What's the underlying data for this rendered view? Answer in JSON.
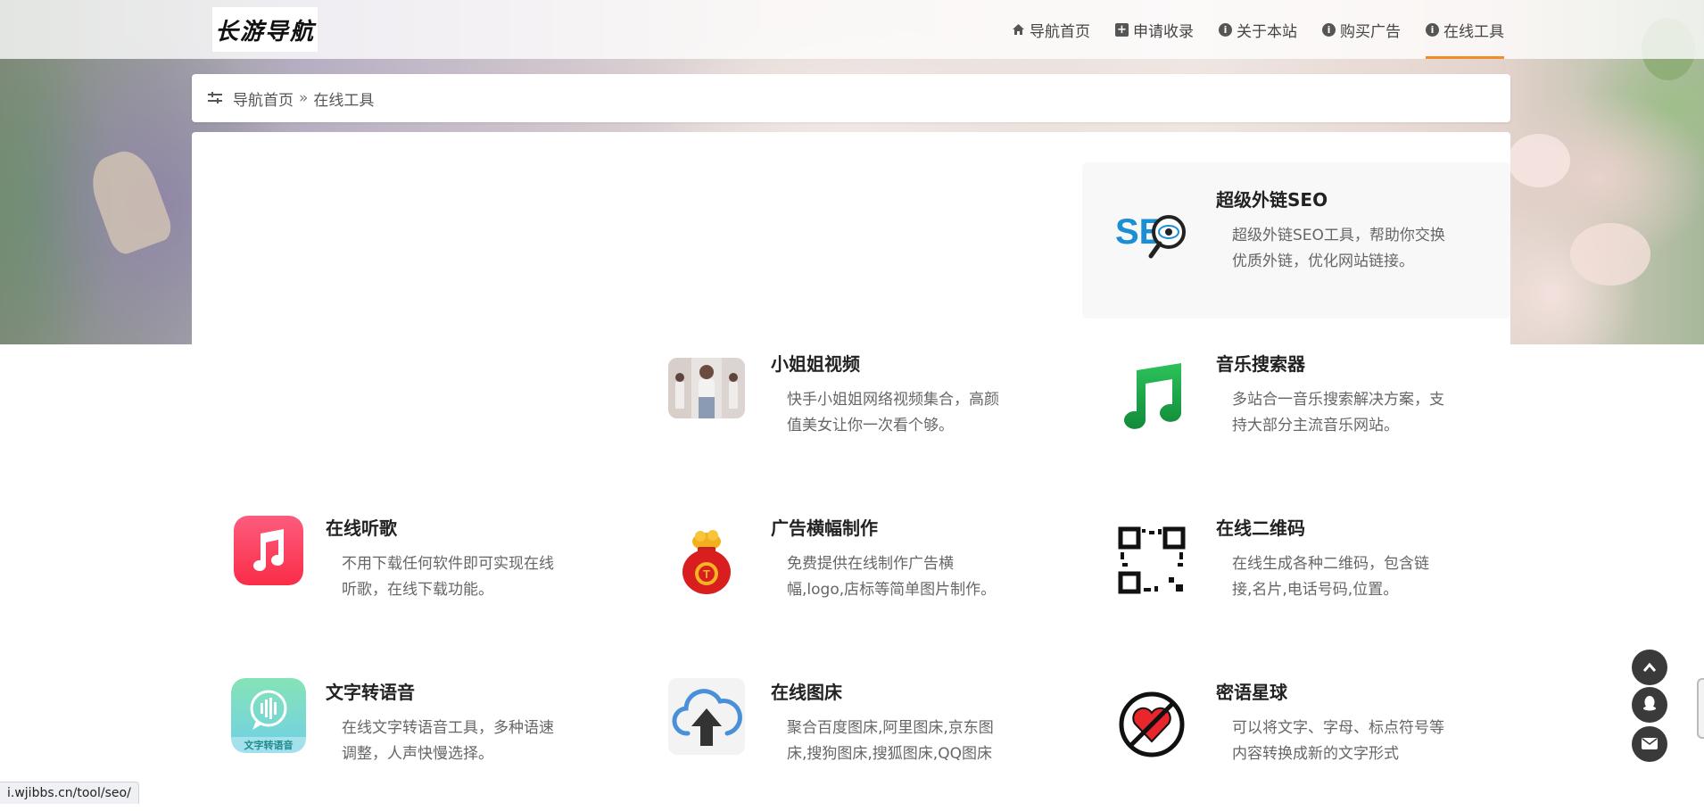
{
  "site": {
    "logo_text": "长游导航"
  },
  "nav": [
    {
      "label": "导航首页",
      "icon": "home-icon"
    },
    {
      "label": "申请收录",
      "icon": "plus-square-icon"
    },
    {
      "label": "关于本站",
      "icon": "info-icon"
    },
    {
      "label": "购买广告",
      "icon": "info-icon"
    },
    {
      "label": "在线工具",
      "icon": "info-icon",
      "active": true
    }
  ],
  "breadcrumb": {
    "home": "导航首页",
    "separator": "»",
    "current": "在线工具"
  },
  "cards": [
    {
      "title": "超级外链SEO",
      "desc": "超级外链SEO工具，帮助你交换优质外链，优化网站链接。",
      "icon": "seo-magnifier-icon"
    },
    {
      "title": "小姐姐视频",
      "desc": "快手小姐姐网络视频集合，高颜值美女让你一次看个够。",
      "icon": "video-thumbnail-icon"
    },
    {
      "title": "音乐搜索器",
      "desc": "多站合一音乐搜索解决方案，支持大部分主流音乐网站。",
      "icon": "music-note-icon"
    },
    {
      "title": "在线听歌",
      "desc": "不用下载任何软件即可实现在线听歌，在线下载功能。",
      "icon": "apple-music-icon"
    },
    {
      "title": "广告横幅制作",
      "desc": "免费提供在线制作广告横幅,logo,店标等简单图片制作。",
      "icon": "lucky-bag-icon"
    },
    {
      "title": "在线二维码",
      "desc": "在线生成各种二维码，包含链接,名片,电话号码,位置。",
      "icon": "qr-code-icon"
    },
    {
      "title": "文字转语音",
      "desc": "在线文字转语音工具，多种语速调整，人声快慢选择。",
      "icon": "text-to-speech-icon",
      "badge": "文字转语音"
    },
    {
      "title": "在线图床",
      "desc": "聚合百度图床,阿里图床,京东图床,搜狗图床,搜狐图床,QQ图床",
      "icon": "cloud-upload-icon"
    },
    {
      "title": "密语星球",
      "desc": "可以将文字、字母、标点符号等内容转换成新的文字形式",
      "icon": "heart-forbidden-icon"
    }
  ],
  "colors": {
    "accent": "#f28c28",
    "float_button": "#3a3a3a",
    "seo_blue": "#1a8fd6",
    "music_green": "#1ba34a",
    "apple_music_red": "#fb3b55",
    "tts_green": "#7ad9a8",
    "cloud_blue": "#4a90d9",
    "heart_red": "#e8262c"
  },
  "float_buttons": [
    {
      "icon": "chevron-up-icon"
    },
    {
      "icon": "qq-icon"
    },
    {
      "icon": "mail-icon"
    }
  ],
  "status_bar": {
    "url": "i.wjibbs.cn/tool/seo/"
  }
}
